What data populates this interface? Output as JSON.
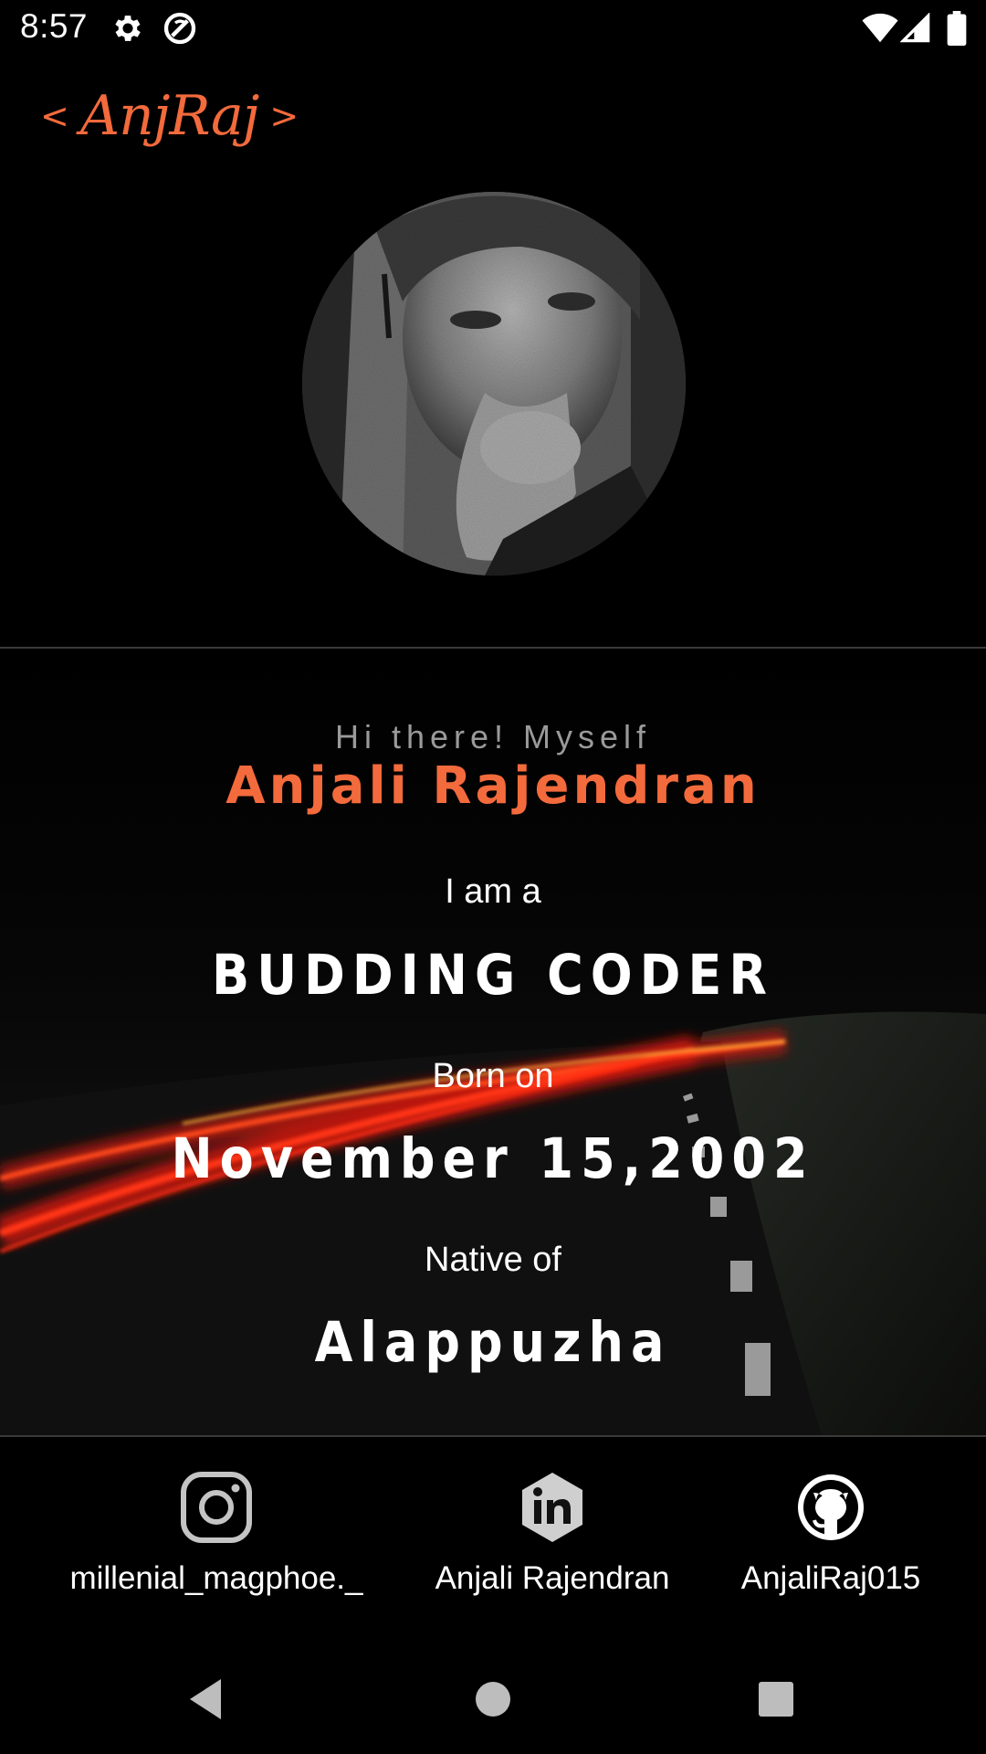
{
  "status_bar": {
    "time": "8:57",
    "icons": [
      "gear-icon",
      "sync-icon",
      "wifi-icon",
      "signal-icon",
      "battery-icon"
    ]
  },
  "logo": {
    "open_bracket": "<",
    "text": "AnjRaj",
    "close_bracket": ">"
  },
  "intro": {
    "greeting": "Hi there! Myself",
    "name": "Anjali Rajendran"
  },
  "details": {
    "role_label": "I am a",
    "role_value": "BUDDING CODER",
    "born_label": "Born on",
    "born_value": "November 15,2002",
    "native_label": "Native of",
    "native_value": "Alappuzha"
  },
  "socials": {
    "instagram": "millenial_magphoe._",
    "linkedin": "Anjali Rajendran",
    "github": "AnjaliRaj015"
  },
  "colors": {
    "accent": "#f36a3c",
    "background": "#000000",
    "text": "#ffffff",
    "muted": "#9a9a9a"
  }
}
